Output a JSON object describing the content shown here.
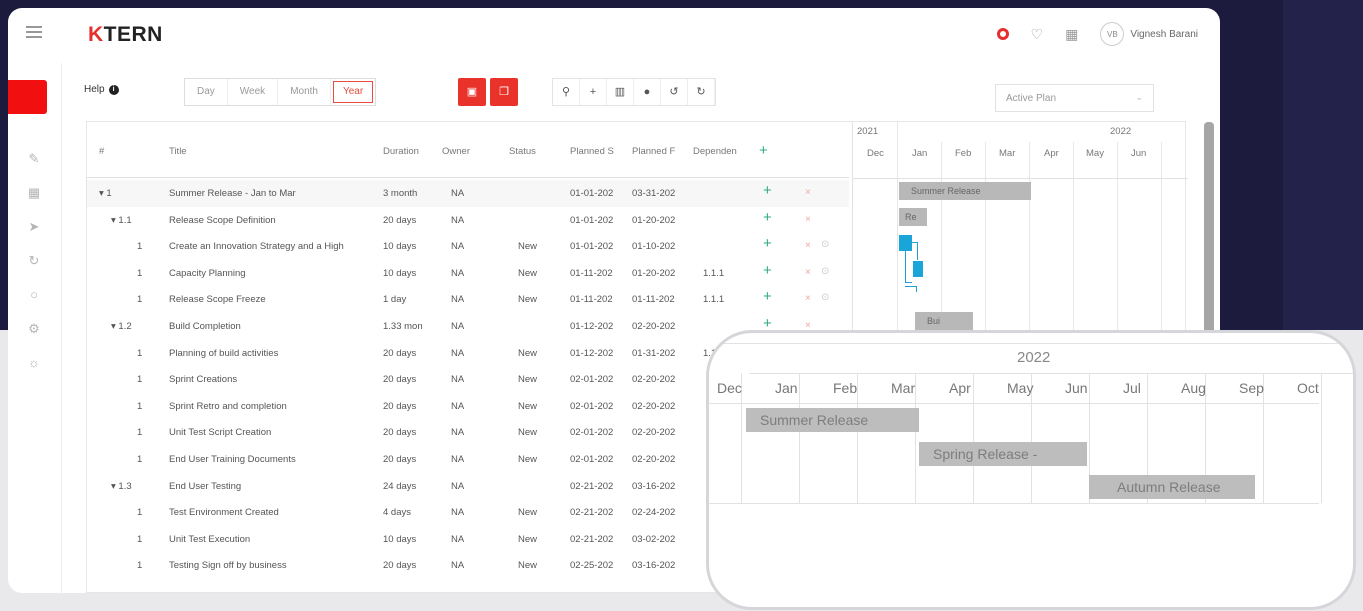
{
  "app": {
    "logo_k": "K",
    "logo_rest": "TERN",
    "user_initials": "VB",
    "user_name": "Vignesh Barani"
  },
  "toolbar": {
    "help_label": "Help",
    "help_icon": "info-icon",
    "views": [
      "Day",
      "Week",
      "Month",
      "Year"
    ],
    "active_view": "Year",
    "plan_select": "Active Plan"
  },
  "grid": {
    "columns": [
      "#",
      "Title",
      "Duration",
      "Owner",
      "Status",
      "Planned S",
      "Planned F",
      "Dependen"
    ],
    "rows": [
      {
        "num": "▾ 1",
        "title": "Summer Release - Jan to Mar",
        "duration": "3 month",
        "owner": "NA",
        "status": "",
        "ps": "01-01-202",
        "pf": "03-31-202",
        "dep": ""
      },
      {
        "num": "▾ 1.1",
        "title": "Release Scope Definition",
        "duration": "20 days",
        "owner": "NA",
        "status": "",
        "ps": "01-01-202",
        "pf": "01-20-202",
        "dep": ""
      },
      {
        "num": "1",
        "title": "Create an Innovation Strategy and a High",
        "duration": "10 days",
        "owner": "NA",
        "status": "New",
        "ps": "01-01-202",
        "pf": "01-10-202",
        "dep": ""
      },
      {
        "num": "1",
        "title": "Capacity Planning",
        "duration": "10 days",
        "owner": "NA",
        "status": "New",
        "ps": "01-11-202",
        "pf": "01-20-202",
        "dep": "1.1.1"
      },
      {
        "num": "1",
        "title": "Release Scope Freeze",
        "duration": "1 day",
        "owner": "NA",
        "status": "New",
        "ps": "01-11-202",
        "pf": "01-11-202",
        "dep": "1.1.1"
      },
      {
        "num": "▾ 1.2",
        "title": "Build Completion",
        "duration": "1.33 mon",
        "owner": "NA",
        "status": "",
        "ps": "01-12-202",
        "pf": "02-20-202",
        "dep": ""
      },
      {
        "num": "1",
        "title": "Planning of build activities",
        "duration": "20 days",
        "owner": "NA",
        "status": "New",
        "ps": "01-12-202",
        "pf": "01-31-202",
        "dep": "1.1.3"
      },
      {
        "num": "1",
        "title": "Sprint Creations",
        "duration": "20 days",
        "owner": "NA",
        "status": "New",
        "ps": "02-01-202",
        "pf": "02-20-202",
        "dep": ""
      },
      {
        "num": "1",
        "title": "Sprint Retro and completion",
        "duration": "20 days",
        "owner": "NA",
        "status": "New",
        "ps": "02-01-202",
        "pf": "02-20-202",
        "dep": ""
      },
      {
        "num": "1",
        "title": "Unit Test Script Creation",
        "duration": "20 days",
        "owner": "NA",
        "status": "New",
        "ps": "02-01-202",
        "pf": "02-20-202",
        "dep": ""
      },
      {
        "num": "1",
        "title": "End User Training Documents",
        "duration": "20 days",
        "owner": "NA",
        "status": "New",
        "ps": "02-01-202",
        "pf": "02-20-202",
        "dep": ""
      },
      {
        "num": "▾ 1.3",
        "title": "End User Testing",
        "duration": "24 days",
        "owner": "NA",
        "status": "",
        "ps": "02-21-202",
        "pf": "03-16-202",
        "dep": ""
      },
      {
        "num": "1",
        "title": "Test Environment Created",
        "duration": "4 days",
        "owner": "NA",
        "status": "New",
        "ps": "02-21-202",
        "pf": "02-24-202",
        "dep": ""
      },
      {
        "num": "1",
        "title": "Unit Test Execution",
        "duration": "10 days",
        "owner": "NA",
        "status": "New",
        "ps": "02-21-202",
        "pf": "03-02-202",
        "dep": ""
      },
      {
        "num": "1",
        "title": "Testing Sign off by business",
        "duration": "20 days",
        "owner": "NA",
        "status": "New",
        "ps": "02-25-202",
        "pf": "03-16-202",
        "dep": ""
      }
    ]
  },
  "gantt": {
    "years": [
      "2021",
      "2022"
    ],
    "months": [
      "Dec",
      "Jan",
      "Feb",
      "Mar",
      "Apr",
      "May",
      "Jun"
    ],
    "bar_summer": "Summer Release",
    "bar_rel": "Re",
    "bar_bui": "Bui"
  },
  "zoom": {
    "year": "2022",
    "months": [
      "Dec",
      "Jan",
      "Feb",
      "Mar",
      "Apr",
      "May",
      "Jun",
      "Jul",
      "Aug",
      "Sep",
      "Oct"
    ],
    "bars": [
      "Summer Release",
      "Spring Release -",
      "Autumn Release"
    ]
  }
}
